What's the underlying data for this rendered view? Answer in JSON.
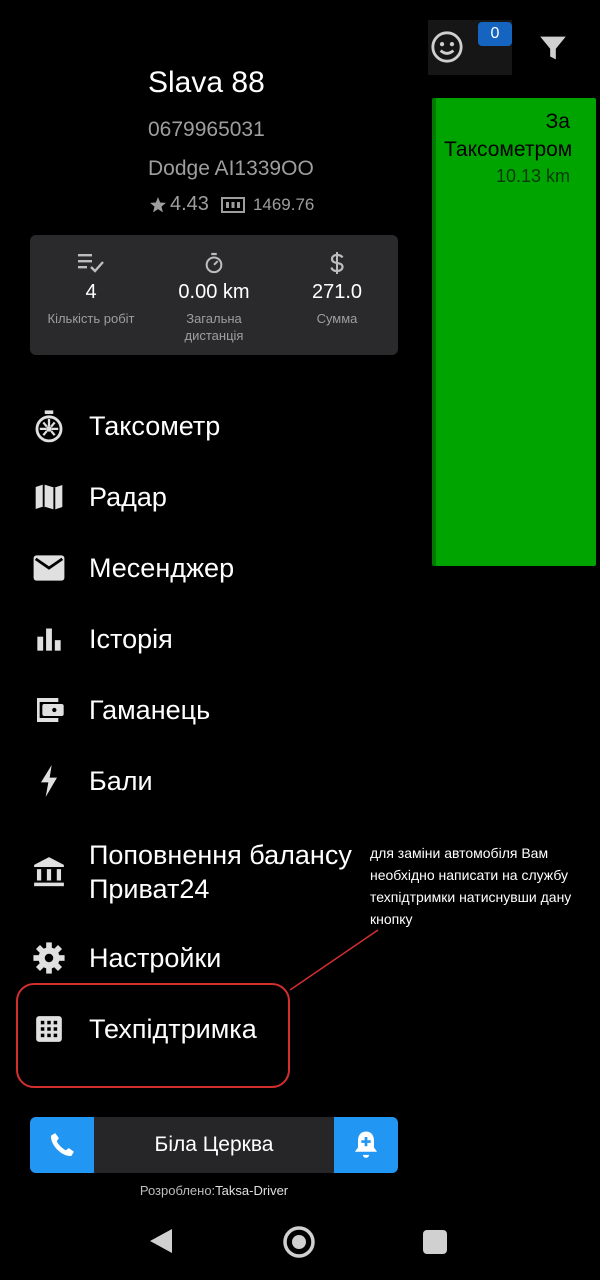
{
  "background_panel": {
    "badge_count": "0",
    "card_title": "За Таксометром",
    "card_distance": "10.13 km",
    "card_color": "#00a400"
  },
  "profile": {
    "name": "Slava 88",
    "phone": "0679965031",
    "car": "Dodge AI1339OO",
    "rating": "4.43",
    "balance": "1469.76"
  },
  "stats": [
    {
      "icon": "checklist-icon",
      "value": "4",
      "label": "Кількість робіт"
    },
    {
      "icon": "timer-icon",
      "value": "0.00 km",
      "label": "Загальна дистанція"
    },
    {
      "icon": "dollar-icon",
      "value": "271.0",
      "label": "Сумма"
    }
  ],
  "menu": [
    {
      "icon": "taximeter-icon",
      "label": "Таксометр"
    },
    {
      "icon": "map-icon",
      "label": "Радар"
    },
    {
      "icon": "mail-icon",
      "label": "Месенджер"
    },
    {
      "icon": "bar-chart-icon",
      "label": "Історія"
    },
    {
      "icon": "wallet-icon",
      "label": "Гаманець"
    },
    {
      "icon": "bolt-icon",
      "label": "Бали"
    },
    {
      "icon": "bank-icon",
      "label": "Поповнення балансу Приват24"
    },
    {
      "icon": "gear-icon",
      "label": "Настройки"
    },
    {
      "icon": "grid-icon",
      "label": "Техпідтримка"
    }
  ],
  "annotation": {
    "text": "для заміни автомобіля Вам необхідно написати на службу техпідтримки натиснувши дану кнопку",
    "color": "#d32f2f"
  },
  "city_bar": {
    "city": "Біла Церква",
    "accent": "#2196f3"
  },
  "credits": {
    "prefix": "Розроблено:",
    "author": "Taksa-Driver"
  }
}
